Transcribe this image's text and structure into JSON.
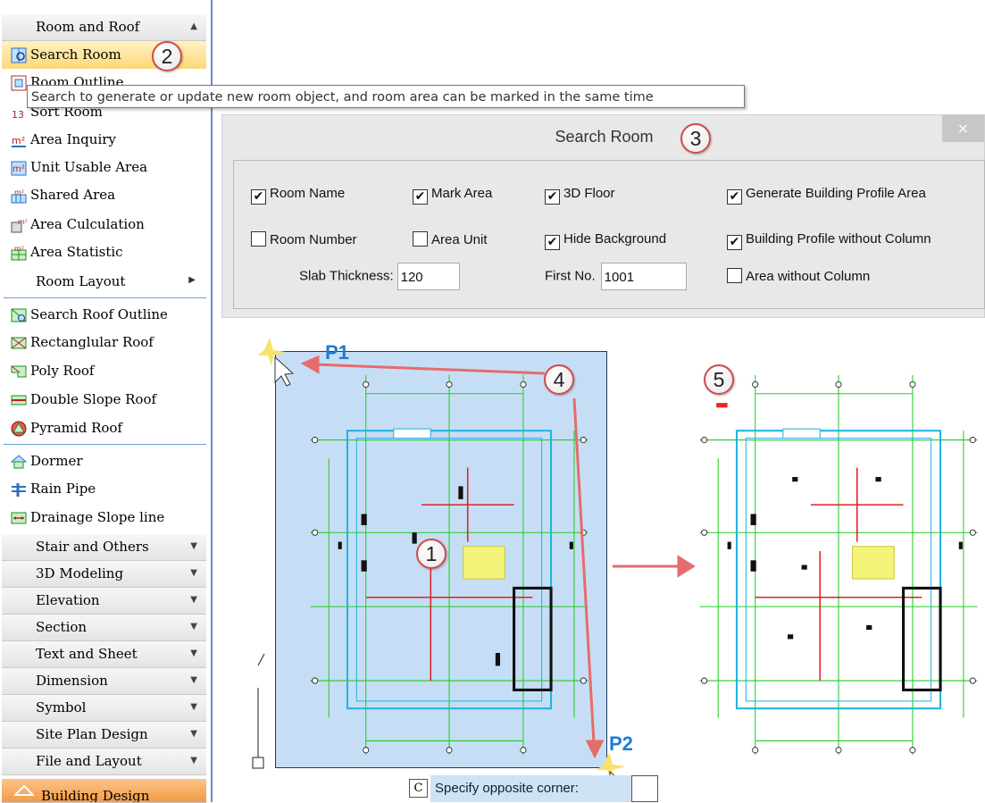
{
  "sidebar": {
    "header": {
      "label": "Room and Roof"
    },
    "items": [
      {
        "label": "Search Room",
        "icon": "search-room-icon"
      },
      {
        "label": "Room Outline",
        "icon": "room-outline-icon"
      },
      {
        "label": "Sort Room",
        "icon": "sort-room-icon"
      },
      {
        "label": "Area Inquiry",
        "icon": "area-inquiry-icon"
      },
      {
        "label": "Unit Usable Area",
        "icon": "unit-usable-area-icon"
      },
      {
        "label": "Shared Area",
        "icon": "shared-area-icon"
      },
      {
        "label": "Area Culculation",
        "icon": "area-calculation-icon"
      },
      {
        "label": "Area Statistic",
        "icon": "area-statistic-icon"
      },
      {
        "label": "Room Layout",
        "icon": ""
      },
      {
        "label": "Search Roof Outline",
        "icon": "search-roof-outline-icon"
      },
      {
        "label": "Rectanglular Roof",
        "icon": "rectangular-roof-icon"
      },
      {
        "label": "Poly Roof",
        "icon": "poly-roof-icon"
      },
      {
        "label": "Double Slope Roof",
        "icon": "double-slope-roof-icon"
      },
      {
        "label": "Pyramid Roof",
        "icon": "pyramid-roof-icon"
      },
      {
        "label": "Dormer",
        "icon": "dormer-icon"
      },
      {
        "label": "Rain Pipe",
        "icon": "rain-pipe-icon"
      },
      {
        "label": "Drainage Slope line",
        "icon": "drainage-slope-icon"
      }
    ],
    "sections": [
      {
        "label": "Stair and Others"
      },
      {
        "label": "3D Modeling"
      },
      {
        "label": "Elevation"
      },
      {
        "label": "Section"
      },
      {
        "label": "Text and Sheet"
      },
      {
        "label": "Dimension"
      },
      {
        "label": "Symbol"
      },
      {
        "label": "Site Plan Design"
      },
      {
        "label": "File and Layout"
      }
    ],
    "footer": {
      "label": "Building Design"
    }
  },
  "tooltip": {
    "text": "Search to generate or update new room object, and room area can be marked in the same time"
  },
  "dialog": {
    "title": "Search Room",
    "close_label": "×",
    "checkboxes": [
      {
        "label": "Room Name",
        "checked": true
      },
      {
        "label": "Mark Area",
        "checked": true
      },
      {
        "label": "3D Floor",
        "checked": true
      },
      {
        "label": "Generate Building Profile Area",
        "checked": true
      },
      {
        "label": "Room Number",
        "checked": false
      },
      {
        "label": "Area Unit",
        "checked": false
      },
      {
        "label": "Hide Background",
        "checked": true
      },
      {
        "label": "Building Profile without Column",
        "checked": true
      },
      {
        "label": "Area without Column",
        "checked": false
      }
    ],
    "slab_thickness": {
      "label": "Slab Thickness:",
      "value": "120"
    },
    "first_no": {
      "label": "First No.",
      "value": "1001"
    }
  },
  "canvas": {
    "p1_label": "P1",
    "p2_label": "P2",
    "step_labels": [
      "1",
      "2",
      "3",
      "4",
      "5"
    ]
  },
  "command": {
    "icon_letter": "C",
    "text": "Specify opposite corner:"
  },
  "colors": {
    "highlight": "#fdd77a",
    "selection": "#c6def5",
    "accent": "#1e7cd6",
    "annotation": "#e56c6c",
    "wall_green": "#22cc22",
    "wall_cyan": "#1fb5e0"
  }
}
